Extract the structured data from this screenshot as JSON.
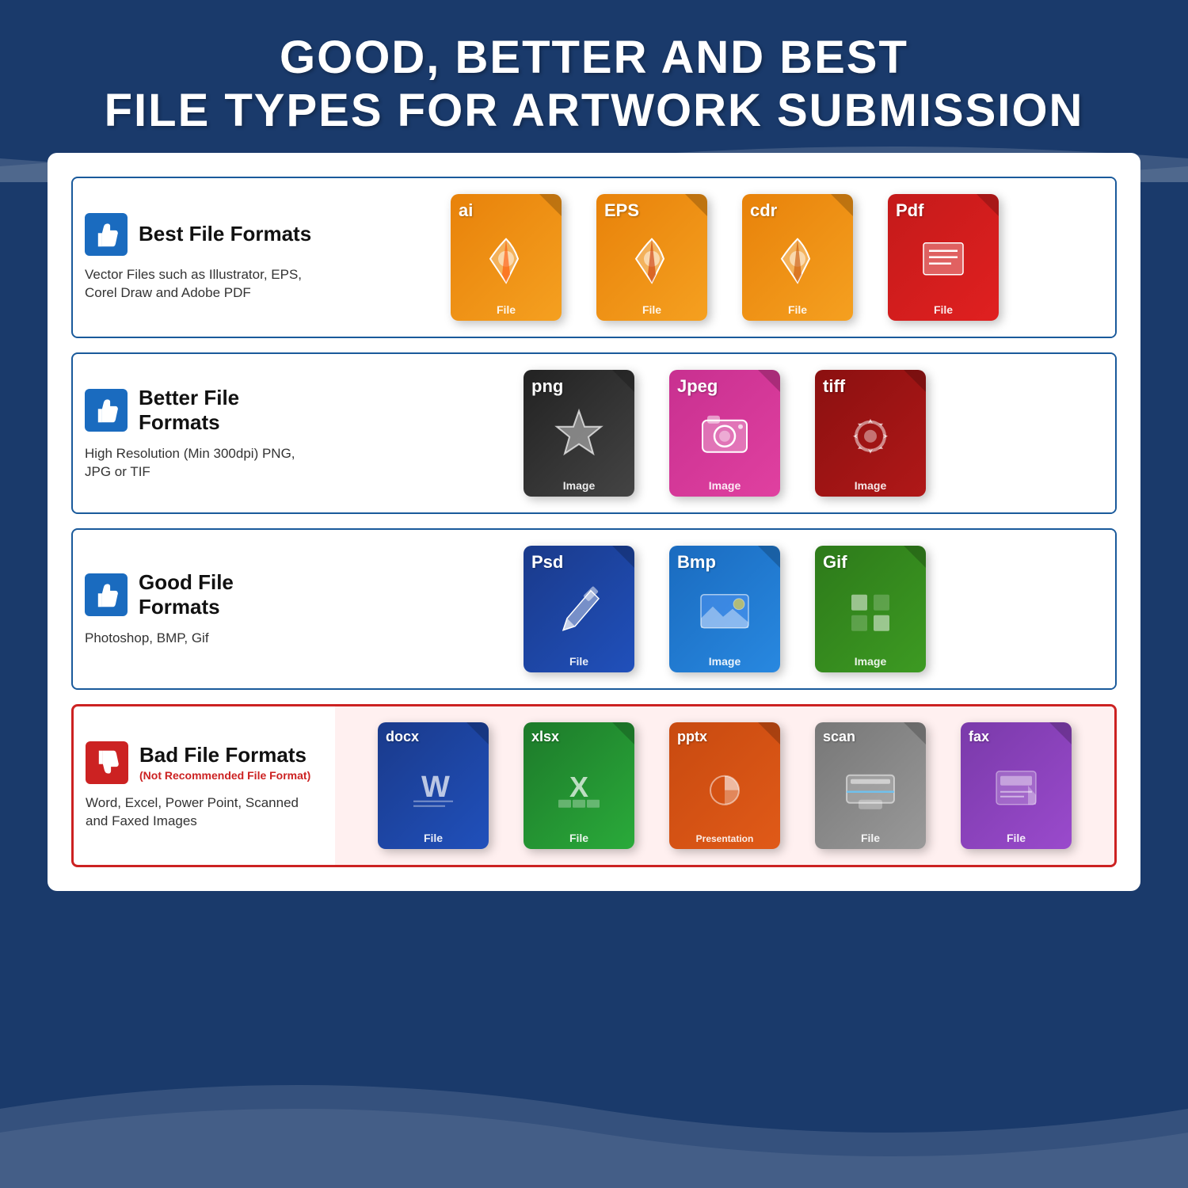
{
  "header": {
    "line1": "GOOD, BETTER AND BEST",
    "line2": "FILE TYPES FOR ARTWORK SUBMISSION"
  },
  "rows": [
    {
      "id": "best",
      "label": "Best File Formats",
      "subtitle": null,
      "description": "Vector Files such as Illustrator, EPS, Corel Draw and Adobe PDF",
      "thumbType": "up",
      "borderColor": "#1a5a9b",
      "files": [
        {
          "ext": "ai",
          "color": "orange",
          "bottomLabel": "File",
          "iconType": "pen"
        },
        {
          "ext": "EPS",
          "color": "orange",
          "bottomLabel": "File",
          "iconType": "pen"
        },
        {
          "ext": "cdr",
          "color": "orange",
          "bottomLabel": "File",
          "iconType": "pen"
        },
        {
          "ext": "Pdf",
          "color": "red-file",
          "bottomLabel": "File",
          "iconType": "doc"
        }
      ]
    },
    {
      "id": "better",
      "label": "Better File Formats",
      "subtitle": null,
      "description": "High Resolution (Min 300dpi) PNG, JPG or TIF",
      "thumbType": "up",
      "borderColor": "#1a5a9b",
      "files": [
        {
          "ext": "png",
          "color": "dark-gray",
          "bottomLabel": "Image",
          "iconType": "star"
        },
        {
          "ext": "Jpeg",
          "color": "pink",
          "bottomLabel": "Image",
          "iconType": "camera"
        },
        {
          "ext": "tiff",
          "color": "dark-red",
          "bottomLabel": "Image",
          "iconType": "gear"
        }
      ]
    },
    {
      "id": "good",
      "label": "Good File Formats",
      "subtitle": null,
      "description": "Photoshop, BMP, Gif",
      "thumbType": "up",
      "borderColor": "#1a5a9b",
      "files": [
        {
          "ext": "Psd",
          "color": "dark-blue",
          "bottomLabel": "File",
          "iconType": "brush"
        },
        {
          "ext": "Bmp",
          "color": "blue",
          "bottomLabel": "Image",
          "iconType": "landscape"
        },
        {
          "ext": "Gif",
          "color": "green-file",
          "bottomLabel": "Image",
          "iconType": "grid"
        }
      ]
    },
    {
      "id": "bad",
      "label": "Bad File Formats",
      "subtitle": "(Not Recommended File Format)",
      "description": "Word, Excel, Power Point, Scanned and Faxed Images",
      "thumbType": "down",
      "borderColor": "#cc2222",
      "files": [
        {
          "ext": "docx",
          "color": "word-blue",
          "bottomLabel": "File",
          "iconType": "word"
        },
        {
          "ext": "xlsx",
          "color": "excel-green",
          "bottomLabel": "File",
          "iconType": "excel"
        },
        {
          "ext": "pptx",
          "color": "ppt-orange",
          "bottomLabel": "Presentation",
          "iconType": "ppt"
        },
        {
          "ext": "scan",
          "color": "scan-gray",
          "bottomLabel": "File",
          "iconType": "scan"
        },
        {
          "ext": "fax",
          "color": "fax-purple",
          "bottomLabel": "File",
          "iconType": "fax"
        }
      ]
    }
  ]
}
